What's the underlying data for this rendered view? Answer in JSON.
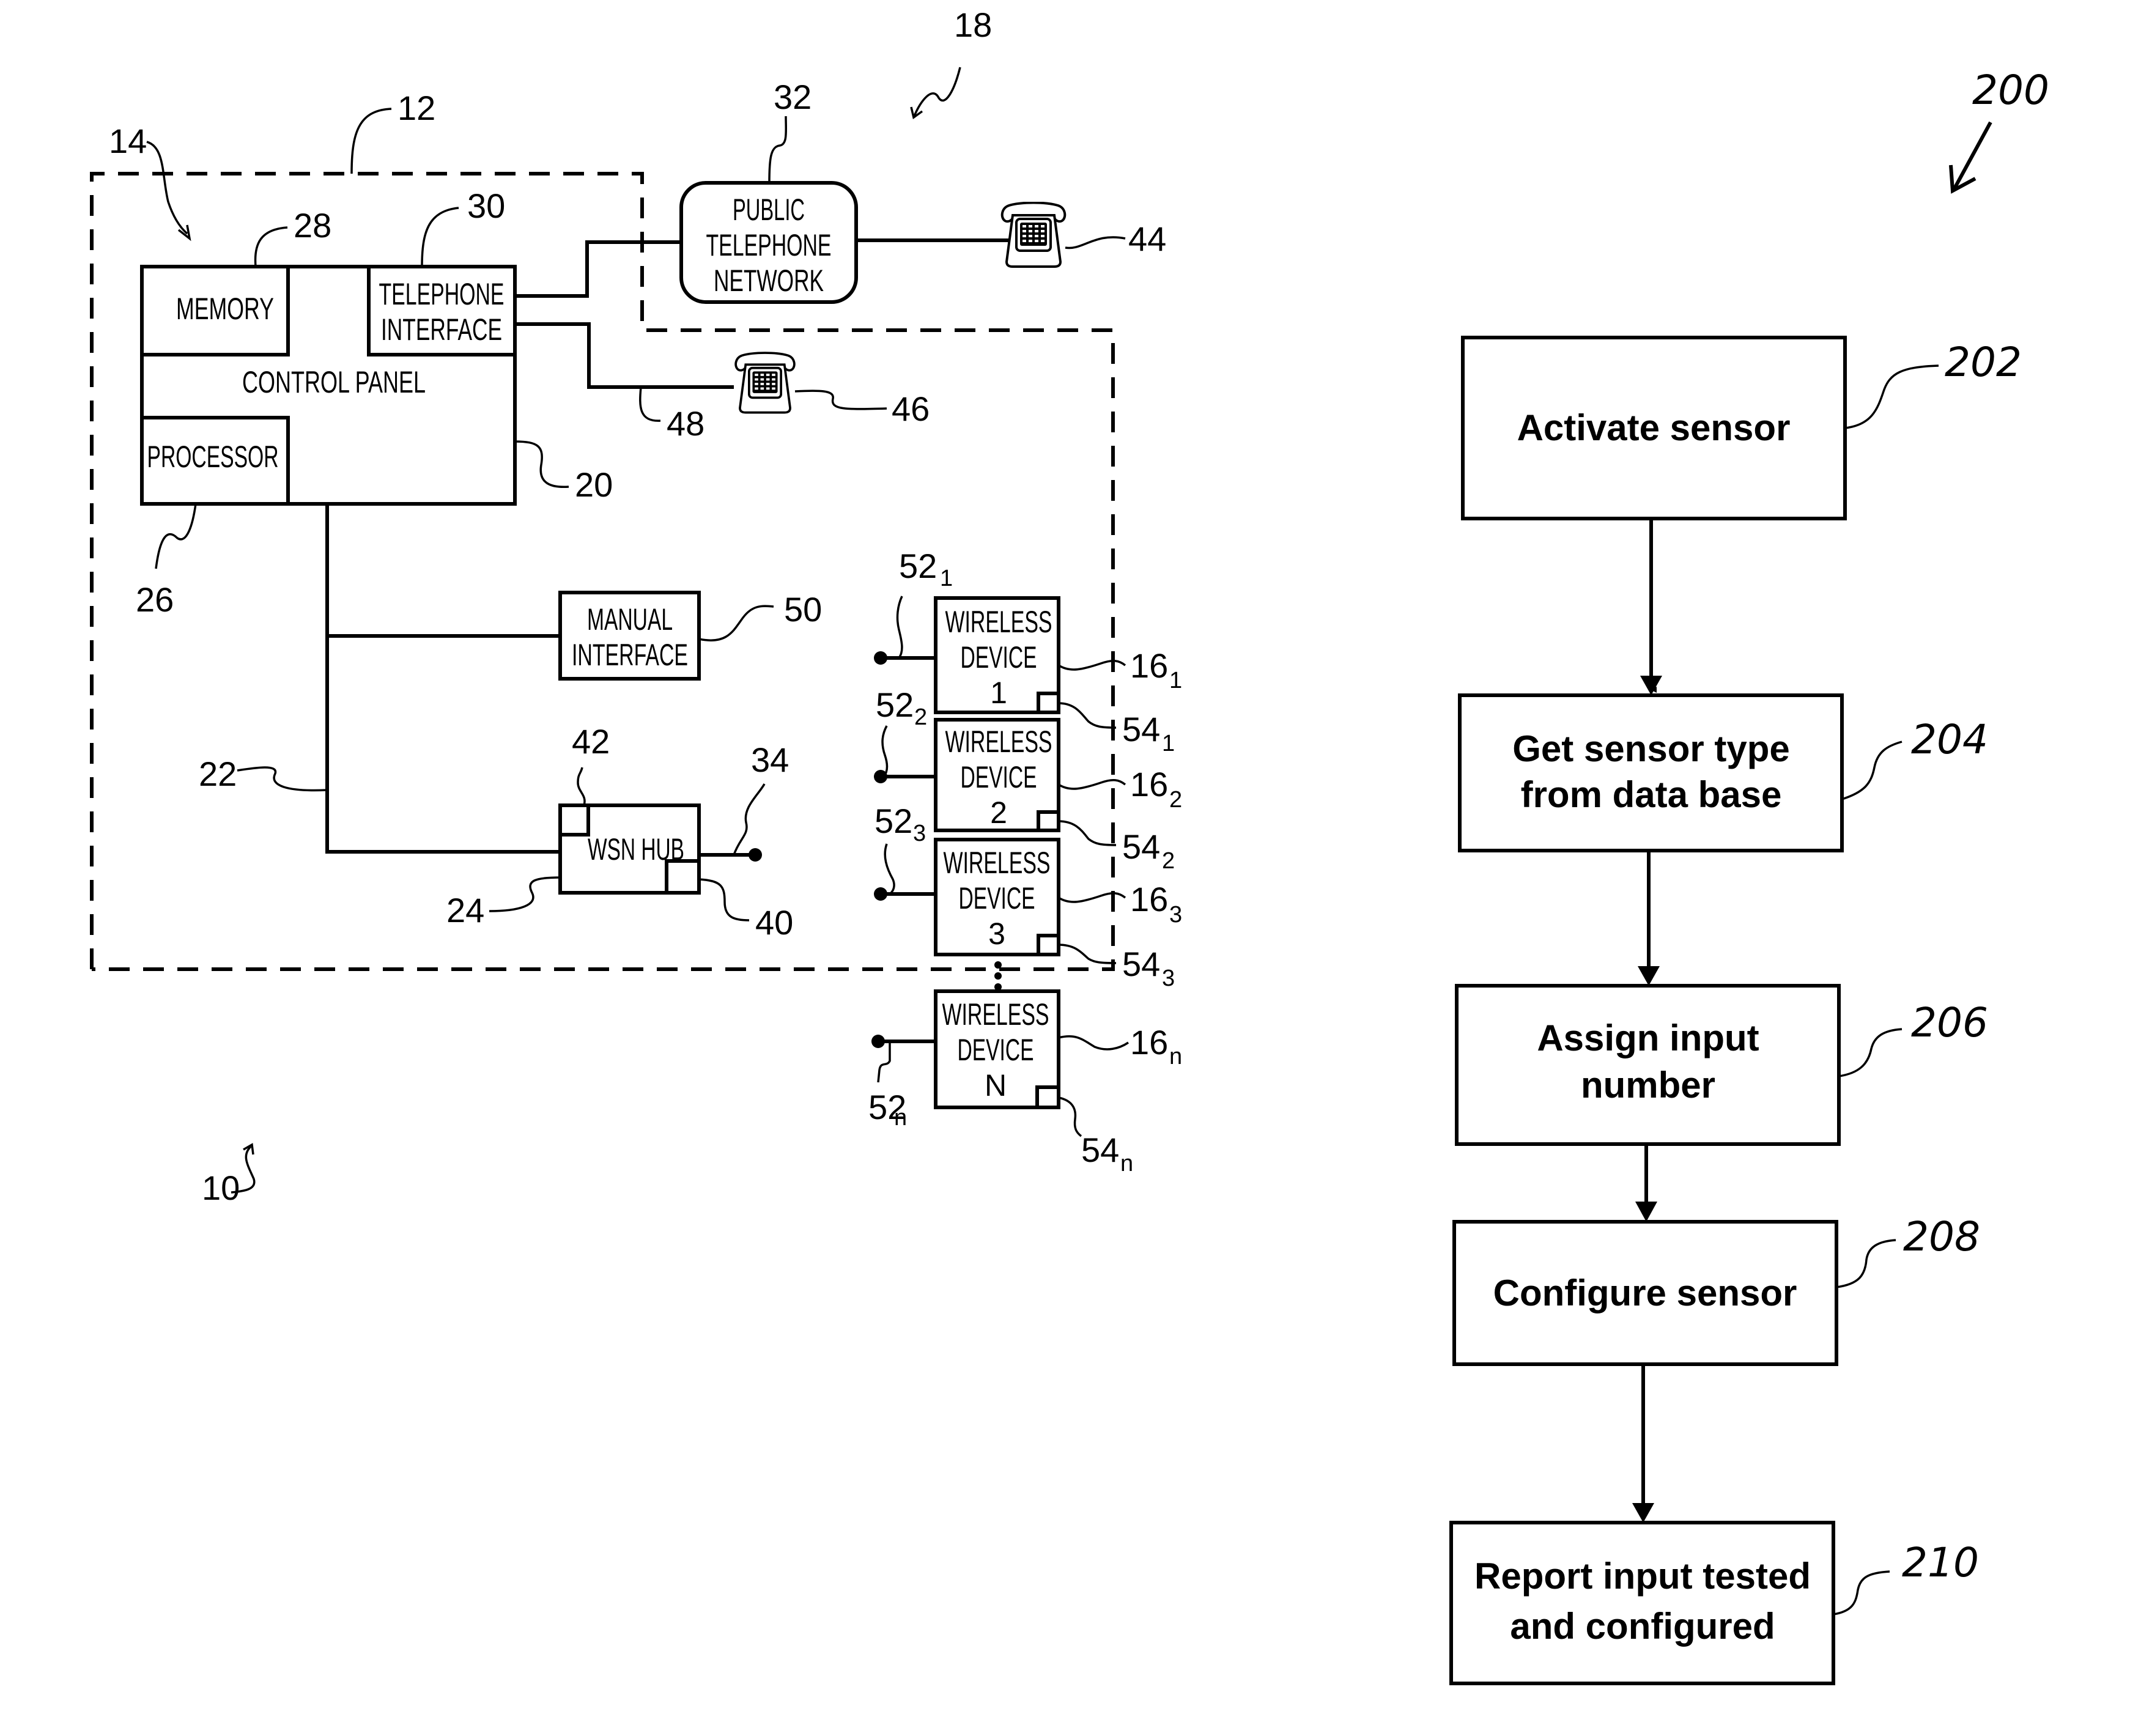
{
  "figure_left": {
    "system_ref": "10",
    "dashed_boundary_ref": "12",
    "premises_ref": "14",
    "network_ref": "18",
    "control_panel": {
      "label": "CONTROL PANEL",
      "ref": "20",
      "memory": {
        "label": "MEMORY",
        "ref": "28"
      },
      "telephone_interface": {
        "line1": "TELEPHONE",
        "line2": "INTERFACE",
        "ref": "30"
      },
      "processor": {
        "label": "PROCESSOR",
        "ref": "26"
      }
    },
    "bus_ref": "22",
    "line_ref": "48",
    "public_telephone_network": {
      "line1": "PUBLIC",
      "line2": "TELEPHONE",
      "line3": "NETWORK",
      "ref": "32"
    },
    "phone_remote": {
      "icon": "telephone-icon",
      "ref": "44"
    },
    "phone_local": {
      "icon": "telephone-icon",
      "ref": "46"
    },
    "manual_interface": {
      "line1": "MANUAL",
      "line2": "INTERFACE",
      "ref": "50"
    },
    "wsn_hub": {
      "label": "WSN HUB",
      "ref": "24",
      "antenna_ref": "34",
      "corner_ref_bottom": "40",
      "corner_ref_top": "42"
    },
    "wireless_devices": [
      {
        "line1": "WIRELESS",
        "line2": "DEVICE",
        "line3": "1",
        "ref": "16",
        "ref_sub": "1",
        "antenna_ref": "52",
        "antenna_sub": "1",
        "port_ref": "54",
        "port_sub": "1"
      },
      {
        "line1": "WIRELESS",
        "line2": "DEVICE",
        "line3": "2",
        "ref": "16",
        "ref_sub": "2",
        "antenna_ref": "52",
        "antenna_sub": "2",
        "port_ref": "54",
        "port_sub": "2"
      },
      {
        "line1": "WIRELESS",
        "line2": "DEVICE",
        "line3": "3",
        "ref": "16",
        "ref_sub": "3",
        "antenna_ref": "52",
        "antenna_sub": "3",
        "port_ref": "54",
        "port_sub": "3"
      },
      {
        "line1": "WIRELESS",
        "line2": "DEVICE",
        "line3": "N",
        "ref": "16",
        "ref_sub": "n",
        "antenna_ref": "52",
        "antenna_sub": "n",
        "port_ref": "54",
        "port_sub": "n"
      }
    ]
  },
  "figure_right": {
    "flow_ref": "200",
    "steps": [
      {
        "line1": "Activate sensor",
        "line2": "",
        "ref": "202"
      },
      {
        "line1": "Get sensor type",
        "line2": "from data base",
        "ref": "204"
      },
      {
        "line1": "Assign input",
        "line2": "number",
        "ref": "206"
      },
      {
        "line1": "Configure sensor",
        "line2": "",
        "ref": "208"
      },
      {
        "line1": "Report input tested",
        "line2": "and configured",
        "ref": "210"
      }
    ]
  }
}
